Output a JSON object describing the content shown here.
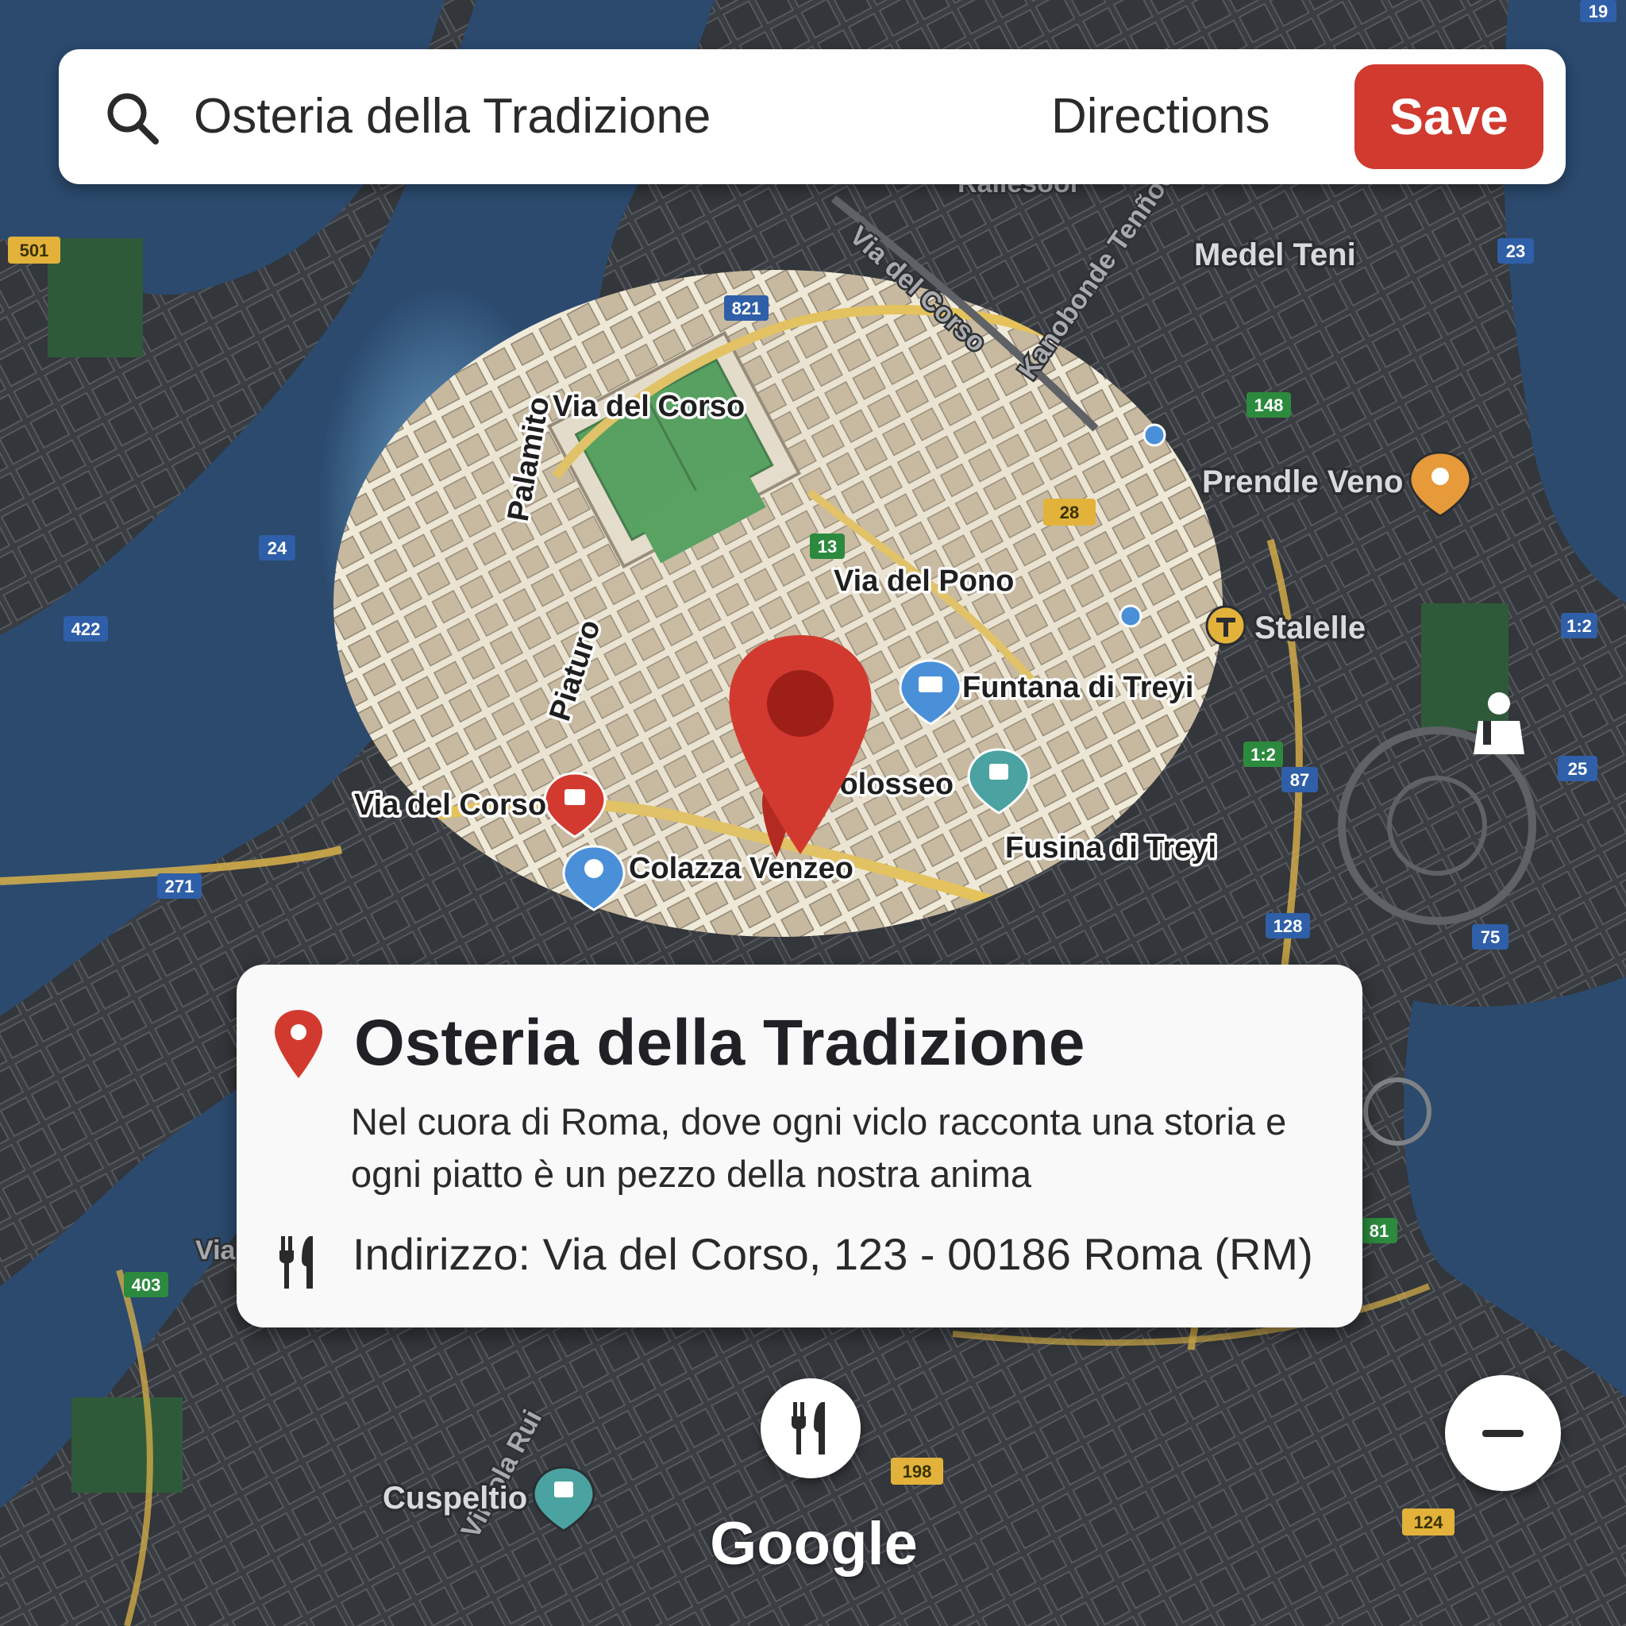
{
  "search": {
    "query": "Osteria della Tradizione",
    "directions_label": "Directions",
    "save_label": "Save"
  },
  "map": {
    "labels": {
      "via_del_corso_top": "Via del Corso",
      "via_del_pono": "Via del Pono",
      "funtana_di_treyi": "Funtana di Treyi",
      "colosseo": "Colosseo",
      "via_del_corso_left": "Via del Corso",
      "colazza_venzeo": "Colazza Venzeo",
      "fusina_di_treyi": "Fusina di Treyi",
      "stalelle": "Stalelle",
      "prendle_veno": "Prendle Veno",
      "medel_teni": "Medel Teni",
      "via_del_corso_diag": "Via del Corso",
      "cuspeltio": "Cuspeltio",
      "via_short": "Via",
      "piaturo": "Piaturo",
      "palamito": "Palamito",
      "viareola": "Vireola Rui",
      "raliesool": "Raliesool",
      "kanobonde": "Kanobonde Tenñoe"
    },
    "shields": [
      "821",
      "24",
      "422",
      "271",
      "13",
      "28",
      "148",
      "23",
      "1:2",
      "25",
      "87",
      "1:2",
      "75",
      "128",
      "81",
      "403",
      "198",
      "124",
      "19",
      "501"
    ],
    "colors": {
      "water": "#2b4a6e",
      "water_highlight": "#6da9d8",
      "land_dark": "#3a3d42",
      "land_light": "#cdbfa8",
      "road_dark": "#5e6166",
      "road_major": "#d9b24a",
      "park": "#3f6e45",
      "pin_red": "#d33a2f",
      "poi_blue": "#4a90d9",
      "poi_teal": "#4aa3a0",
      "poi_yellow": "#e2b23b"
    }
  },
  "card": {
    "title": "Osteria della Tradizione",
    "description": "Nel cuora di Roma, dove ogni viclo racconta una storia e ogni piatto è un pezzo della nostra anima",
    "address": "Indirizzo: Via del Corso, 123 - 00186 Roma (RM)"
  },
  "branding": {
    "logo_text": "Google"
  },
  "icons": {
    "search": "search-icon",
    "card_pin": "map-pin-icon",
    "utensils": "fork-knife-icon",
    "zoom_out": "minus-icon"
  }
}
